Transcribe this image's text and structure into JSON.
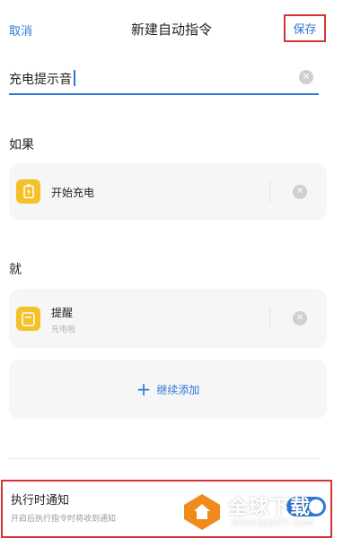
{
  "header": {
    "cancel_label": "取消",
    "title": "新建自动指令",
    "save_label": "保存"
  },
  "name_field": {
    "value": "充电提示音"
  },
  "if_section": {
    "label": "如果",
    "card": {
      "title": "开始充电",
      "icon": "charging-icon"
    }
  },
  "then_section": {
    "label": "就",
    "card": {
      "title": "提醒",
      "subtitle": "充电啦",
      "icon": "reminder-icon"
    }
  },
  "add_button": {
    "label": "继续添加",
    "icon": "plus-icon"
  },
  "notify": {
    "title": "执行时通知",
    "description": "开启后执行指令时将收到通知",
    "toggle_on": true
  },
  "watermark": {
    "text": "全球下载",
    "url": "www.qq241.com"
  },
  "colors": {
    "accent": "#2f78d6",
    "highlight_border": "#d53434",
    "icon_yellow": "#f5c128",
    "watermark_orange": "#f08a1c"
  }
}
